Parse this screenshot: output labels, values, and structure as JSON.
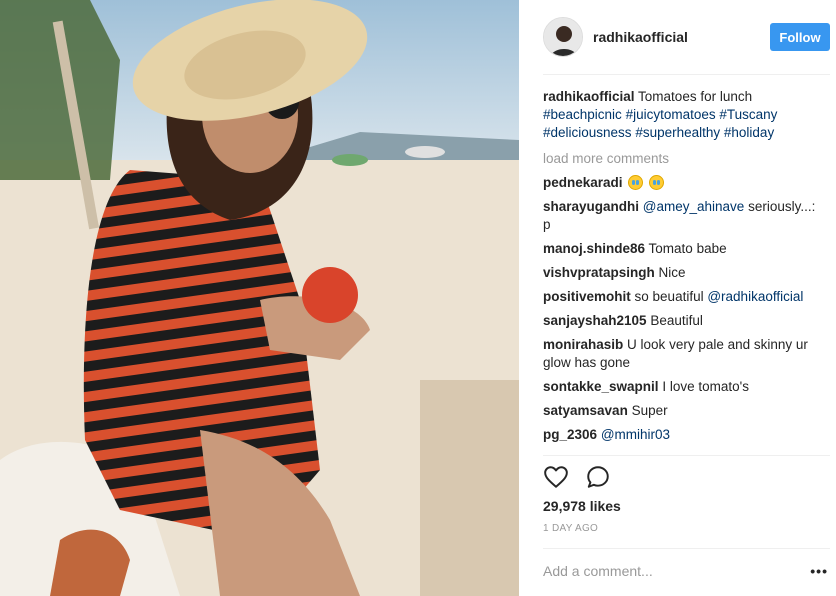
{
  "post": {
    "username": "radhikaofficial",
    "follow_label": "Follow",
    "caption": {
      "user": "radhikaofficial",
      "text": "Tomatoes for lunch",
      "hashtags": [
        "#beachpicnic",
        "#juicytomatoes",
        "#Tuscany",
        "#deliciousness",
        "#superhealthy",
        "#holiday"
      ]
    },
    "load_more": "load more comments",
    "comments": [
      {
        "user": "pednekaradi",
        "text": "",
        "emoji_count": 2
      },
      {
        "user": "sharayugandhi",
        "mention": "@amey_ahinave",
        "text": " seriously...: p"
      },
      {
        "user": "manoj.shinde86",
        "text": "Tomato babe"
      },
      {
        "user": "vishvpratapsingh",
        "text": "Nice"
      },
      {
        "user": "positivemohit",
        "text": "so beuatiful ",
        "mention": "@radhikaofficial"
      },
      {
        "user": "sanjayshah2105",
        "text": "Beautiful"
      },
      {
        "user": "monirahasib",
        "text": "U look very pale and skinny ur glow has gone"
      },
      {
        "user": "sontakke_swapnil",
        "text": "I love tomato's"
      },
      {
        "user": "satyamsavan",
        "text": "Super"
      },
      {
        "user": "pg_2306",
        "mention": "@mmihir03",
        "text": ""
      }
    ],
    "likes": "29,978 likes",
    "timestamp": "1 DAY AGO",
    "add_comment_placeholder": "Add a comment...",
    "more_label": "•••"
  },
  "icons": {
    "like": "heart-outline-icon",
    "comment": "speech-bubble-icon",
    "options": "ellipsis-icon"
  },
  "colors": {
    "follow": "#3897f0",
    "link": "#003569",
    "muted": "#999999"
  }
}
